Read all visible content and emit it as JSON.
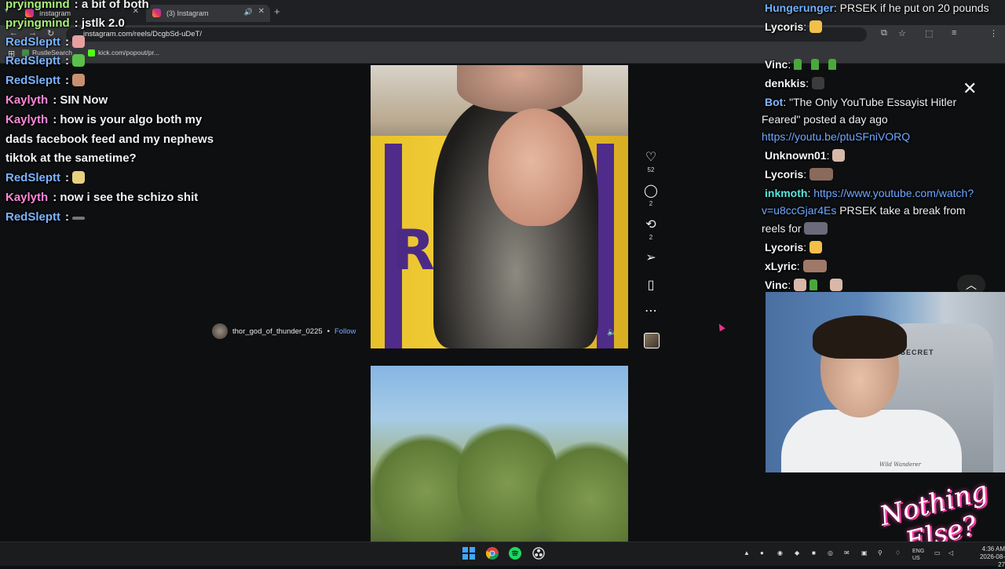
{
  "browser": {
    "tabs": [
      {
        "label": "Instagram",
        "icon": "instagram-icon"
      },
      {
        "label": "(3) Instagram",
        "icon": "instagram-icon"
      }
    ],
    "new_tab_symbol": "+",
    "url": "instagram.com/reels/DcgbSd-uDeT/",
    "bookmarks": [
      {
        "label": "RustleSearch"
      },
      {
        "label": "kick.com/popout/pr..."
      }
    ]
  },
  "left_chat": [
    {
      "user": "pryingmind",
      "text": "a bit of both"
    },
    {
      "user": "pryingmind",
      "text": "jstlk 2.0"
    },
    {
      "user": "RedSleptt",
      "text": ""
    },
    {
      "user": "RedSleptt",
      "text": ""
    },
    {
      "user": "RedSleptt",
      "text": ""
    },
    {
      "user": "Kaylyth",
      "text": "SIN Now"
    },
    {
      "user": "Kaylyth",
      "text": "how is your algo both my"
    },
    {
      "user": "",
      "text": "dads facebook feed and my nephews"
    },
    {
      "user": "",
      "text": "tiktok at the sametime?"
    },
    {
      "user": "RedSleptt",
      "text": ""
    },
    {
      "user": "Kaylyth",
      "text": "now i see the schizo shit"
    },
    {
      "user": "RedSleptt",
      "text": ""
    }
  ],
  "reel": {
    "jersey_text": "RS",
    "author": "thor_god_of_thunder_0225",
    "separator": "•",
    "follow_label": "Follow",
    "likes": "52",
    "comments": "2",
    "reposts": "2"
  },
  "right_chat": {
    "l1": {
      "user": "Hungerunger",
      "text": "PRSEK if he put on 20 pounds"
    },
    "l2": {
      "user": "Lycoris"
    },
    "l3": {
      "user": "Vinc"
    },
    "l4": {
      "user": "denkkis"
    },
    "l5": {
      "user": "Bot",
      "text": "\"The Only YouTube Essayist Hitler"
    },
    "l6": {
      "text": "Feared\" posted a day ago"
    },
    "l7": {
      "link": "https://youtu.be/ptuSFniVORQ"
    },
    "l8": {
      "user": "Unknown01"
    },
    "l9": {
      "user": "Lycoris"
    },
    "l10": {
      "user": "inkmoth",
      "link": "https://www.youtube.com/watch?"
    },
    "l11": {
      "link": "v=u8ccGjar4Es",
      "text": "PRSEK take a break from"
    },
    "l12": {
      "text": "reels for"
    },
    "l13": {
      "user": "Lycoris"
    },
    "l14": {
      "user": "xLyric"
    },
    "l15": {
      "user": "Vinc"
    }
  },
  "webcam": {
    "chair_brand": "SECRET",
    "shirt_text": "Wild Wanderer"
  },
  "logo": {
    "line1": "Nothing",
    "line2": "Else?"
  },
  "taskbar": {
    "lang": "ENG",
    "region": "US",
    "time": "4:36 AM",
    "date": "2026-08-27"
  },
  "colors": {
    "pryingmind": "#a8f07a",
    "redsleptt": "#7ab3ff",
    "kaylyth": "#ff88d8",
    "link": "#6fa8ff",
    "inkmoth": "#59e6e0"
  }
}
